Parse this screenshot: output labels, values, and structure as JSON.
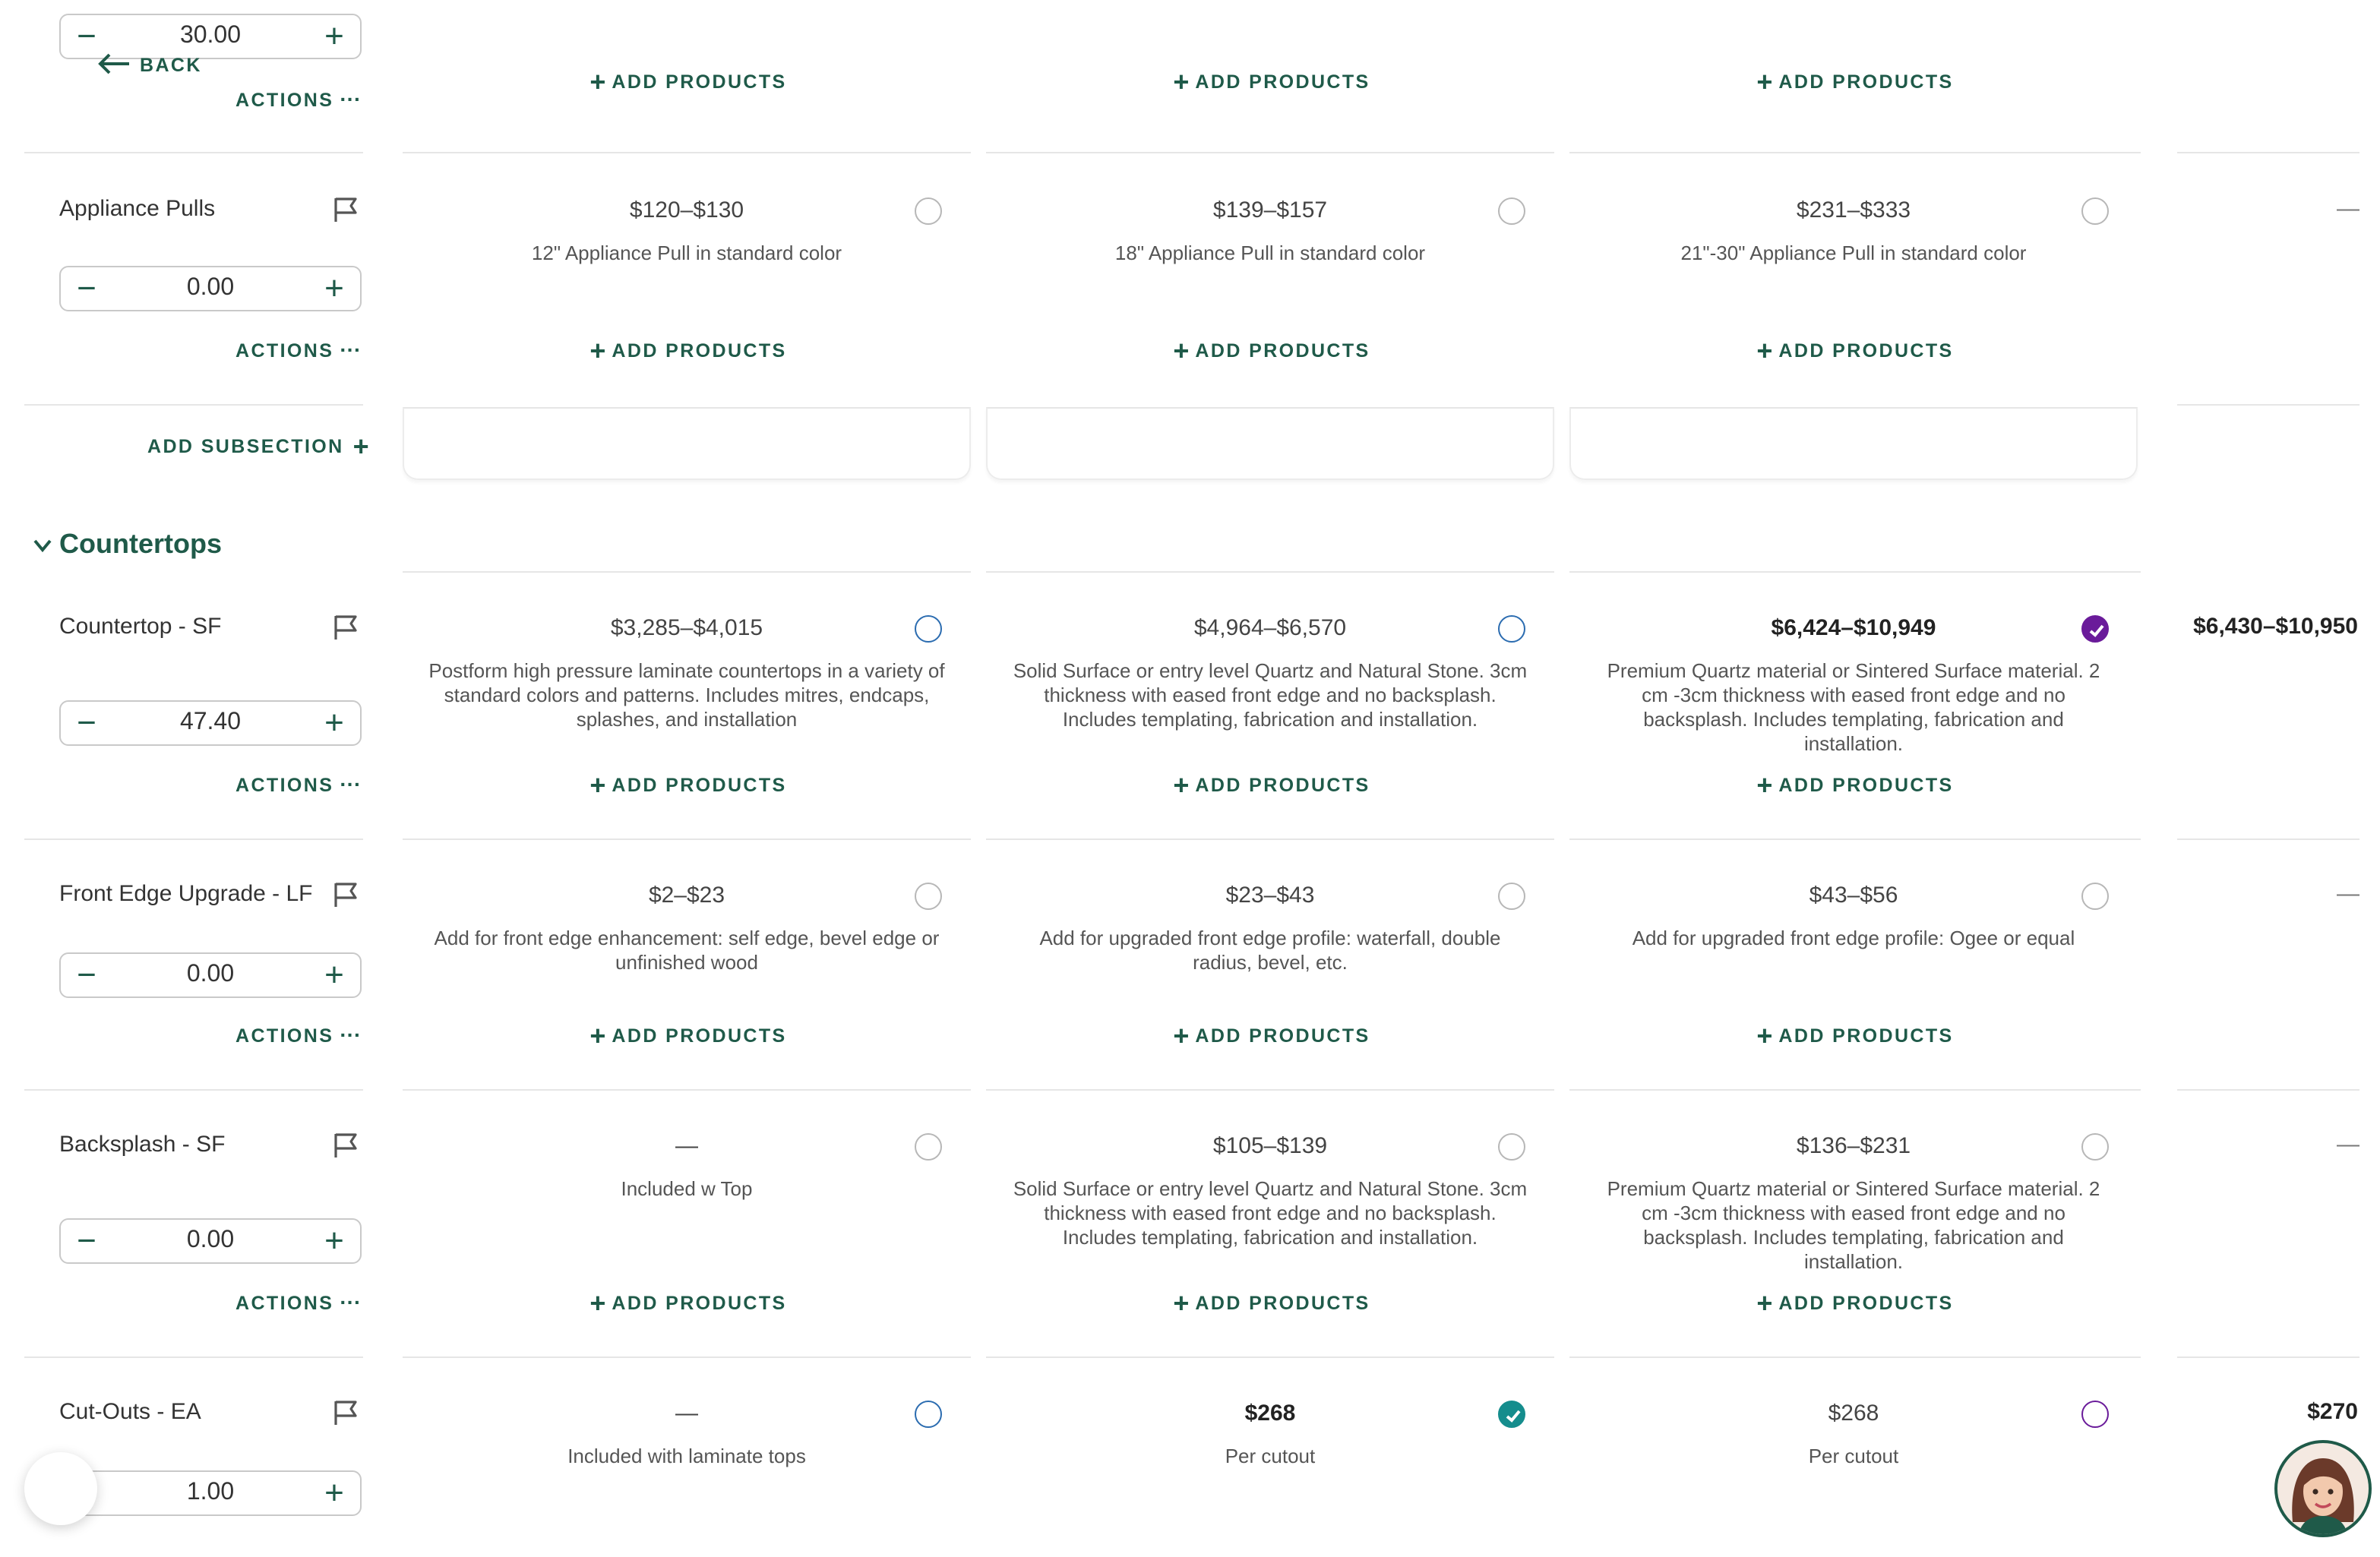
{
  "colors": {
    "brand": "#1f5a49",
    "radio_blue": "#2b6cb0",
    "selected_purple": "#6a1b9a",
    "selected_teal": "#158d8d"
  },
  "top": {
    "quantity": "30.00",
    "back_label": "BACK",
    "actions_label": "ACTIONS",
    "add_products": [
      "ADD PRODUCTS",
      "ADD PRODUCTS",
      "ADD PRODUCTS"
    ]
  },
  "appliance_pulls": {
    "label": "Appliance Pulls",
    "quantity": "0.00",
    "actions_label": "ACTIONS",
    "options": [
      {
        "price": "$120–$130",
        "desc": "12\" Appliance Pull in standard color",
        "add": "ADD PRODUCTS"
      },
      {
        "price": "$139–$157",
        "desc": "18\" Appliance Pull in standard color",
        "add": "ADD PRODUCTS"
      },
      {
        "price": "$231–$333",
        "desc": "21\"-30\" Appliance Pull in standard color",
        "add": "ADD PRODUCTS"
      }
    ],
    "selected_total": "—"
  },
  "add_subsection_label": "ADD SUBSECTION",
  "countertops": {
    "section_title": "Countertops",
    "rows": [
      {
        "label": "Countertop - SF",
        "quantity": "47.40",
        "actions_label": "ACTIONS",
        "options": [
          {
            "price": "$3,285–$4,015",
            "desc": "Postform high pressure laminate countertops in a variety of standard colors and patterns. Includes mitres, endcaps, splashes, and installation",
            "add": "ADD PRODUCTS"
          },
          {
            "price": "$4,964–$6,570",
            "desc": "Solid Surface or entry level Quartz and Natural Stone. 3cm thickness with eased front edge and no backsplash. Includes templating, fabrication and installation.",
            "add": "ADD PRODUCTS"
          },
          {
            "price": "$6,424–$10,949",
            "desc": "Premium Quartz material or Sintered Surface material. 2 cm -3cm thickness with eased front edge and no backsplash. Includes templating, fabrication and installation.",
            "add": "ADD PRODUCTS"
          }
        ],
        "selected_total": "$6,430–$10,950"
      },
      {
        "label": "Front Edge Upgrade - LF",
        "quantity": "0.00",
        "actions_label": "ACTIONS",
        "options": [
          {
            "price": "$2–$23",
            "desc": "Add for front edge enhancement: self edge, bevel edge or unfinished wood",
            "add": "ADD PRODUCTS"
          },
          {
            "price": "$23–$43",
            "desc": "Add for upgraded front edge profile: waterfall, double radius, bevel, etc.",
            "add": "ADD PRODUCTS"
          },
          {
            "price": "$43–$56",
            "desc": "Add for upgraded front edge profile: Ogee or equal",
            "add": "ADD PRODUCTS"
          }
        ],
        "selected_total": "—"
      },
      {
        "label": "Backsplash - SF",
        "quantity": "0.00",
        "actions_label": "ACTIONS",
        "options": [
          {
            "price": "—",
            "desc": "Included w Top",
            "add": "ADD PRODUCTS"
          },
          {
            "price": "$105–$139",
            "desc": "Solid Surface or entry level Quartz and Natural Stone. 3cm thickness with eased front edge and no backsplash. Includes templating, fabrication and installation.",
            "add": "ADD PRODUCTS"
          },
          {
            "price": "$136–$231",
            "desc": "Premium Quartz material or Sintered Surface material. 2 cm -3cm thickness with eased front edge and no backsplash. Includes templating, fabrication and installation.",
            "add": "ADD PRODUCTS"
          }
        ],
        "selected_total": "—"
      },
      {
        "label": "Cut-Outs - EA",
        "quantity": "1.00",
        "options": [
          {
            "price": "—",
            "desc": "Included with laminate tops"
          },
          {
            "price": "$268",
            "desc": "Per cutout"
          },
          {
            "price": "$268",
            "desc": "Per cutout"
          }
        ],
        "selected_total": "$270"
      }
    ]
  }
}
